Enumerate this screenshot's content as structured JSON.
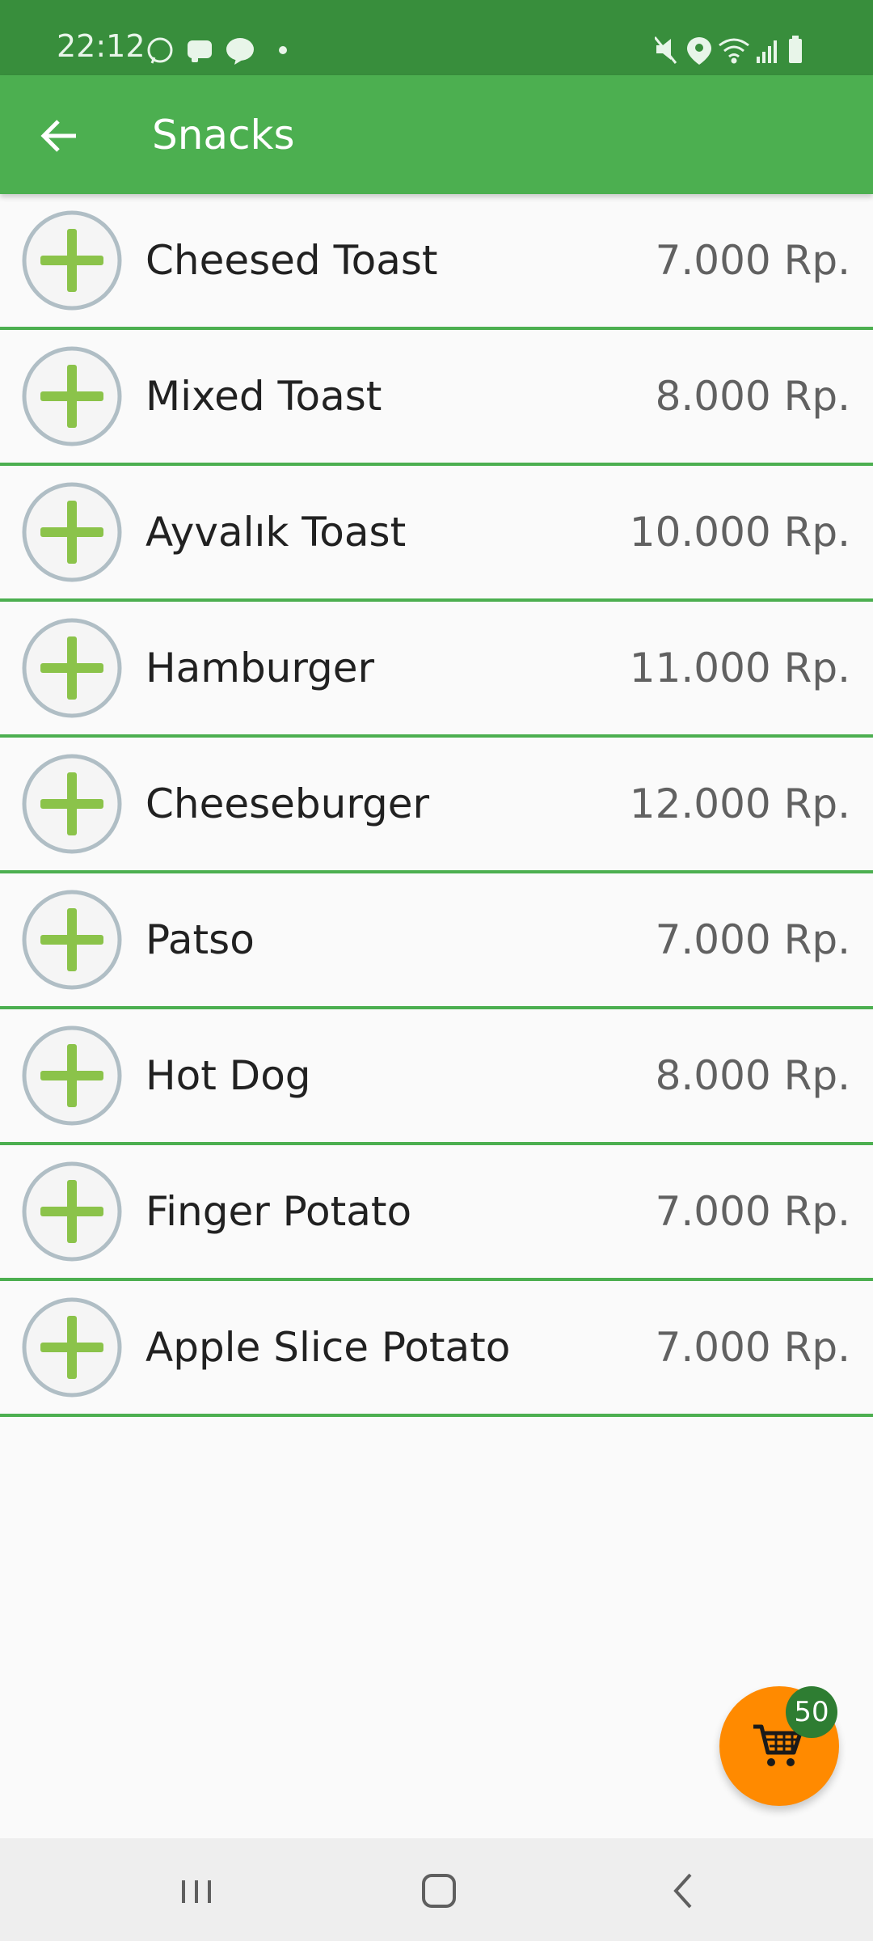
{
  "status_bar": {
    "time": "22:12",
    "left_icons": [
      "whatsapp-icon",
      "messenger-icon",
      "line-icon",
      "dot-icon"
    ],
    "right_icons": [
      "mute-icon",
      "location-icon",
      "wifi-icon",
      "signal-icon",
      "battery-icon"
    ]
  },
  "app_bar": {
    "title": "Snacks"
  },
  "items": [
    {
      "name": "Cheesed Toast",
      "price": "7.000 Rp."
    },
    {
      "name": "Mixed Toast",
      "price": "8.000 Rp."
    },
    {
      "name": "Ayvalık Toast",
      "price": "10.000 Rp."
    },
    {
      "name": "Hamburger",
      "price": "11.000 Rp."
    },
    {
      "name": "Cheeseburger",
      "price": "12.000 Rp."
    },
    {
      "name": "Patso",
      "price": "7.000 Rp."
    },
    {
      "name": "Hot Dog",
      "price": "8.000 Rp."
    },
    {
      "name": "Finger Potato",
      "price": "7.000 Rp."
    },
    {
      "name": "Apple Slice Potato",
      "price": "7.000 Rp."
    }
  ],
  "cart": {
    "count": "50"
  },
  "colors": {
    "status_bar": "#388e3c",
    "app_bar": "#4caf50",
    "divider": "#4caf50",
    "plus": "#8bc34a",
    "fab": "#ff8a00",
    "badge": "#2e7d32"
  }
}
